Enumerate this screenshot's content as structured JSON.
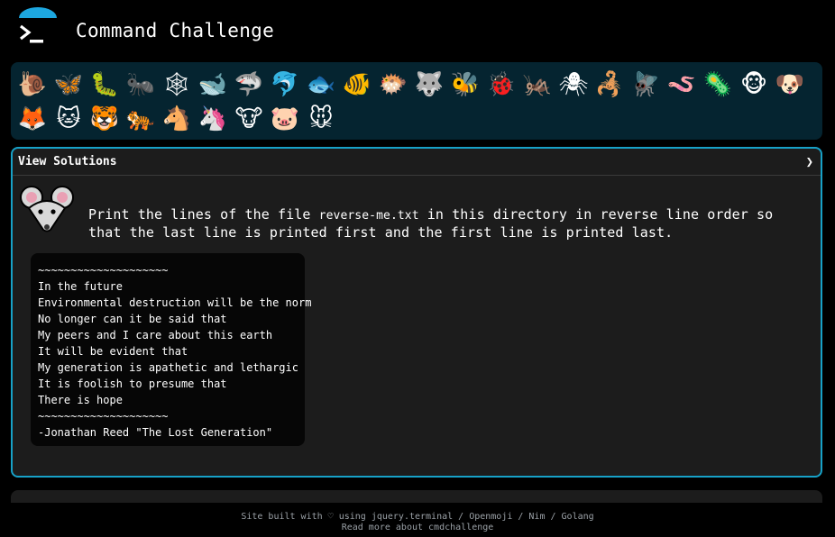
{
  "header": {
    "title": "Command Challenge",
    "logo_colors": {
      "arc": "#1da7e0",
      "prompt": "#ffffff"
    }
  },
  "challenges": [
    {
      "icon": "🐌",
      "name": "snail-icon"
    },
    {
      "icon": "🦋",
      "name": "butterfly-icon"
    },
    {
      "icon": "🐛",
      "name": "caterpillar-icon"
    },
    {
      "icon": "🐜",
      "name": "ant-icon"
    },
    {
      "icon": "🕸",
      "name": "spider-web-icon"
    },
    {
      "icon": "🐋",
      "name": "whale-icon"
    },
    {
      "icon": "🦈",
      "name": "shark-icon"
    },
    {
      "icon": "🐬",
      "name": "dolphin-icon"
    },
    {
      "icon": "🐟",
      "name": "fish-icon"
    },
    {
      "icon": "🐠",
      "name": "tropical-fish-icon"
    },
    {
      "icon": "🐡",
      "name": "blowfish-icon"
    },
    {
      "icon": "🐺",
      "name": "wolf-icon"
    },
    {
      "icon": "🐝",
      "name": "bee-icon"
    },
    {
      "icon": "🐞",
      "name": "ladybug-icon"
    },
    {
      "icon": "🦗",
      "name": "cricket-icon"
    },
    {
      "icon": "🕷",
      "name": "spider-icon"
    },
    {
      "icon": "🦂",
      "name": "scorpion-icon"
    },
    {
      "icon": "🪰",
      "name": "fly-icon"
    },
    {
      "icon": "🪱",
      "name": "worm-icon"
    },
    {
      "icon": "🦠",
      "name": "microbe-icon"
    },
    {
      "icon": "🐵",
      "name": "monkey-icon"
    },
    {
      "icon": "🐶",
      "name": "dog-icon"
    },
    {
      "icon": "🦊",
      "name": "fox-icon"
    },
    {
      "icon": "🐱",
      "name": "cat-icon"
    },
    {
      "icon": "🐯",
      "name": "tiger-face-icon"
    },
    {
      "icon": "🐅",
      "name": "tiger-icon"
    },
    {
      "icon": "🐴",
      "name": "horse-icon"
    },
    {
      "icon": "🦄",
      "name": "unicorn-icon"
    },
    {
      "icon": "🐮",
      "name": "cow-icon"
    },
    {
      "icon": "🐷",
      "name": "pig-icon"
    },
    {
      "icon": "🐭",
      "name": "mouse-icon"
    }
  ],
  "solutions": {
    "label": "View Solutions",
    "chevron": "❯"
  },
  "task": {
    "before": "Print the lines of the file ",
    "file": "reverse-me.txt",
    "after": " in this directory in reverse line order so that the last line is printed first and the first line is printed last."
  },
  "poem_lines": [
    "~~~~~~~~~~~~~~~~~~~~",
    "In the future",
    "Environmental destruction will be the norm",
    "No longer can it be said that",
    "My peers and I care about this earth",
    "It will be evident that",
    "My generation is apathetic and lethargic",
    "It is foolish to presume that",
    "There is hope",
    "~~~~~~~~~~~~~~~~~~~~",
    "-Jonathan Reed \"The Lost Generation\""
  ],
  "footer": {
    "line1": "Site built with ♡ using jquery.terminal / Openmoji / Nim / Golang",
    "line2": "Read more about cmdchallenge"
  },
  "colors": {
    "accent": "#17a1c7",
    "challenge_bar_bg": "#052430",
    "panel_bg": "#1c1c1c"
  }
}
